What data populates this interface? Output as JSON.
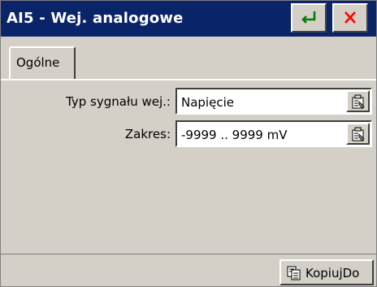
{
  "window": {
    "title": "AI5 - Wej. analogowe",
    "accent_color": "#0a246a",
    "ok_icon": "enter-arrow-icon",
    "close_icon": "close-icon",
    "ok_icon_color": "#008000",
    "close_icon_color": "#ff0000"
  },
  "tabs": [
    {
      "label": "Ogólne",
      "selected": true
    }
  ],
  "form": {
    "rows": [
      {
        "label": "Typ sygnału wej.:",
        "value": "Napięcie",
        "button_icon": "properties-icon"
      },
      {
        "label": "Zakres:",
        "value": "-9999 .. 9999 mV",
        "button_icon": "properties-icon"
      }
    ]
  },
  "footer": {
    "copy_label": "KopiujDo",
    "copy_icon": "copy-icon"
  }
}
